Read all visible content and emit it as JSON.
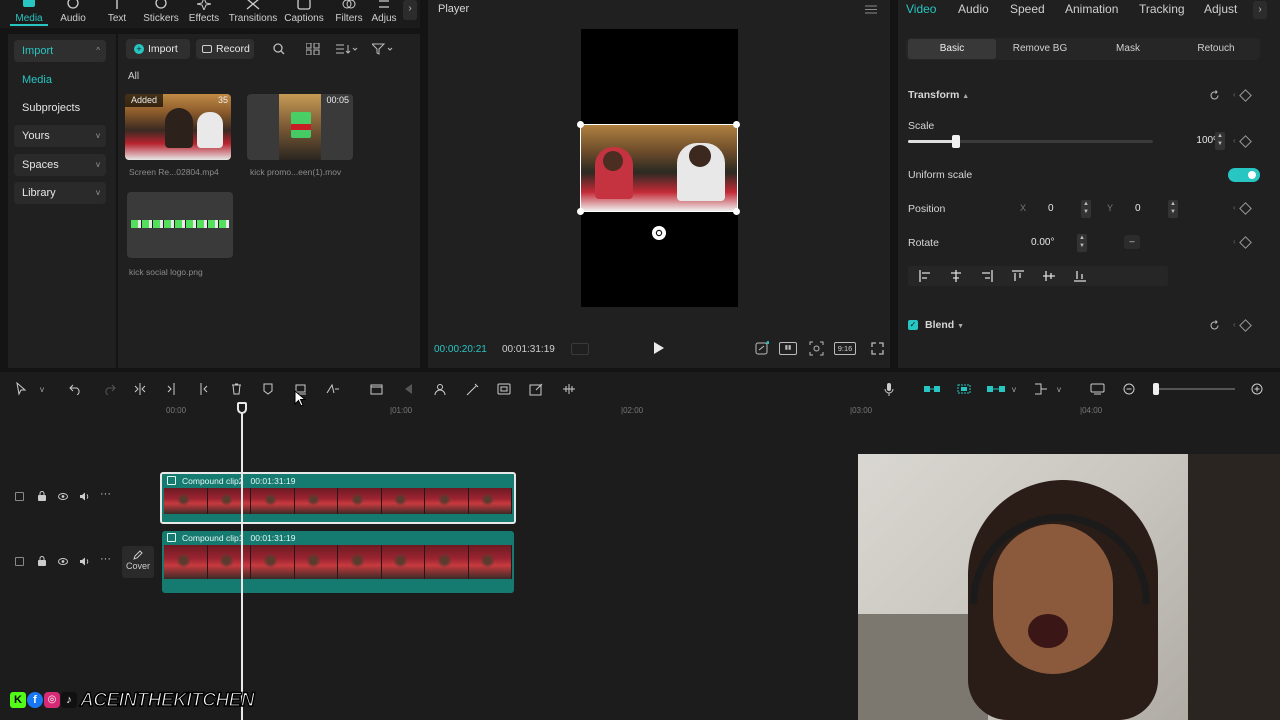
{
  "top_tabs": [
    {
      "label": "Media",
      "icon": "media-icon"
    },
    {
      "label": "Audio",
      "icon": "audio-icon"
    },
    {
      "label": "Text",
      "icon": "text-icon"
    },
    {
      "label": "Stickers",
      "icon": "stickers-icon"
    },
    {
      "label": "Effects",
      "icon": "effects-icon"
    },
    {
      "label": "Transitions",
      "icon": "transitions-icon"
    },
    {
      "label": "Captions",
      "icon": "captions-icon"
    },
    {
      "label": "Filters",
      "icon": "filters-icon"
    },
    {
      "label": "Adjus",
      "icon": "adjust-icon"
    }
  ],
  "sidebar": {
    "items": [
      {
        "label": "Import"
      },
      {
        "label": "Media"
      },
      {
        "label": "Subprojects"
      },
      {
        "label": "Yours"
      },
      {
        "label": "Spaces"
      },
      {
        "label": "Library"
      }
    ]
  },
  "media_toolbar": {
    "import_label": "Import",
    "record_label": "Record",
    "filter_all": "All"
  },
  "media_items": [
    {
      "name": "Screen Re...02804.mp4",
      "badge": "Added",
      "duration": "35"
    },
    {
      "name": "kick promo...een(1).mov",
      "duration": "00:05"
    },
    {
      "name": "kick social logo.png"
    }
  ],
  "player": {
    "title": "Player",
    "current_time": "00:00:20:21",
    "total_time": "00:01:31:19",
    "aspect": "9:16"
  },
  "right_panel": {
    "tabs": [
      "Video",
      "Audio",
      "Speed",
      "Animation",
      "Tracking",
      "Adjust"
    ],
    "subtabs": [
      "Basic",
      "Remove BG",
      "Mask",
      "Retouch"
    ],
    "transform_label": "Transform",
    "scale_label": "Scale",
    "scale_value": "100%",
    "uniform_scale_label": "Uniform scale",
    "position_label": "Position",
    "pos_x_label": "X",
    "pos_x": "0",
    "pos_y_label": "Y",
    "pos_y": "0",
    "rotate_label": "Rotate",
    "rotate_value": "0.00°",
    "blend_label": "Blend"
  },
  "timeline": {
    "ruler": [
      "00:00",
      "|01:00",
      "|02:00",
      "|03:00",
      "|04:00"
    ],
    "clips": [
      {
        "name": "Compound clip2",
        "duration": "00:01:31:19"
      },
      {
        "name": "Compound clip1",
        "duration": "00:01:31:19"
      }
    ],
    "cover_label": "Cover"
  },
  "watermark": {
    "text": "ACEINTHEKITCHEN"
  },
  "colors": {
    "accent": "#27c6c2",
    "clip": "#157a70",
    "bg": "#202020"
  }
}
